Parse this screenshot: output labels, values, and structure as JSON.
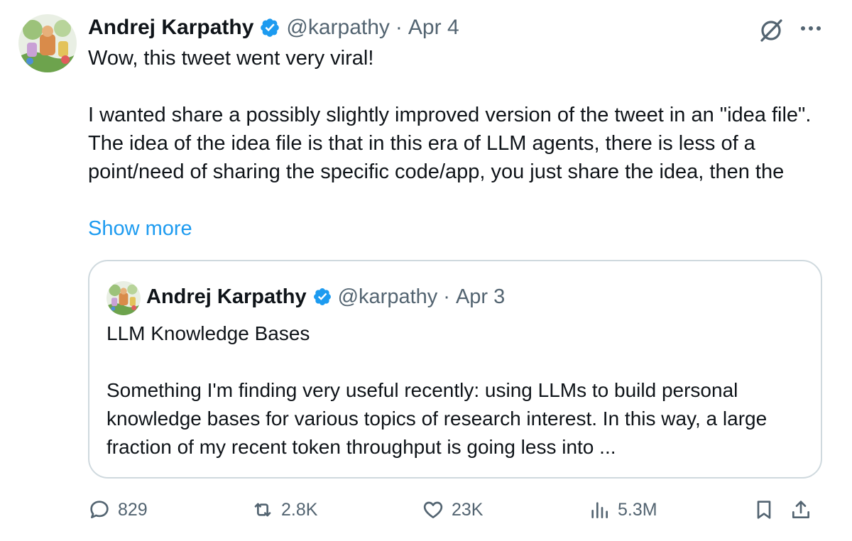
{
  "author": {
    "name": "Andrej Karpathy",
    "handle": "@karpathy",
    "separator": "·",
    "date": "Apr 4",
    "avatar_icon": "avatar-illustration",
    "verified_icon": "verified-badge-icon"
  },
  "tweet": {
    "line1": "Wow, this tweet went very viral!",
    "line2": "I wanted share a possibly slightly improved version of the tweet in an \"idea file\". The idea of the idea file is that in this era of LLM agents, there is less of a point/need of sharing the specific code/app, you just share the idea, then the",
    "show_more": "Show more"
  },
  "header_icons": {
    "grok": "grok-icon",
    "more": "more-icon"
  },
  "quote": {
    "name": "Andrej Karpathy",
    "handle": "@karpathy",
    "separator": "·",
    "date": "Apr 3",
    "title": "LLM Knowledge Bases",
    "body": "Something I'm finding very useful recently: using LLMs to build personal knowledge bases for various topics of research interest. In this way, a large fraction of my recent token throughput is going less into ..."
  },
  "actions": {
    "replies": "829",
    "retweets": "2.8K",
    "likes": "23K",
    "views": "5.3M",
    "icons": [
      "reply-icon",
      "retweet-icon",
      "like-icon",
      "views-icon",
      "bookmark-icon",
      "share-icon"
    ]
  },
  "colors": {
    "text": "#0f1419",
    "secondary": "#536471",
    "link": "#1d9bf0",
    "verified": "#1d9bf0",
    "border": "#cfd9de"
  }
}
